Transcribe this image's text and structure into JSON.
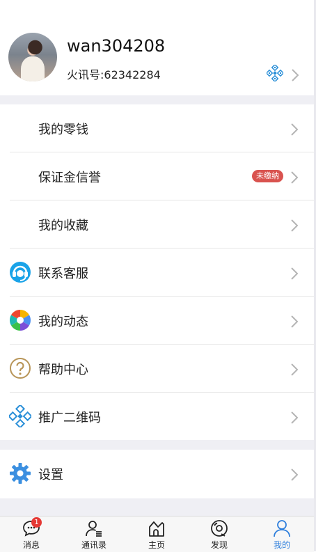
{
  "profile": {
    "username": "wan304208",
    "fire_id": "火讯号:62342284",
    "qr_icon": "qr-code-icon"
  },
  "menu": [
    {
      "label": "我的零钱",
      "icon": null
    },
    {
      "label": "保证金信誉",
      "icon": null,
      "badge": "未缴纳"
    },
    {
      "label": "我的收藏",
      "icon": null
    },
    {
      "label": "联系客服",
      "icon": "headset-icon"
    },
    {
      "label": "我的动态",
      "icon": "aperture-icon"
    },
    {
      "label": "帮助中心",
      "icon": "question-circle-icon"
    },
    {
      "label": "推广二维码",
      "icon": "qr-code-icon"
    }
  ],
  "settings": {
    "label": "设置",
    "icon": "gear-icon"
  },
  "tabbar": {
    "tabs": [
      {
        "label": "消息",
        "icon": "chat-bubble-icon",
        "badge": "1"
      },
      {
        "label": "通讯录",
        "icon": "contacts-icon"
      },
      {
        "label": "主页",
        "icon": "home-icon"
      },
      {
        "label": "发现",
        "icon": "discover-icon"
      },
      {
        "label": "我的",
        "icon": "person-icon",
        "active": true
      }
    ]
  },
  "colors": {
    "accent": "#2f7fdc",
    "badge_red": "#d9534f",
    "divider_bg": "#efeff4"
  }
}
